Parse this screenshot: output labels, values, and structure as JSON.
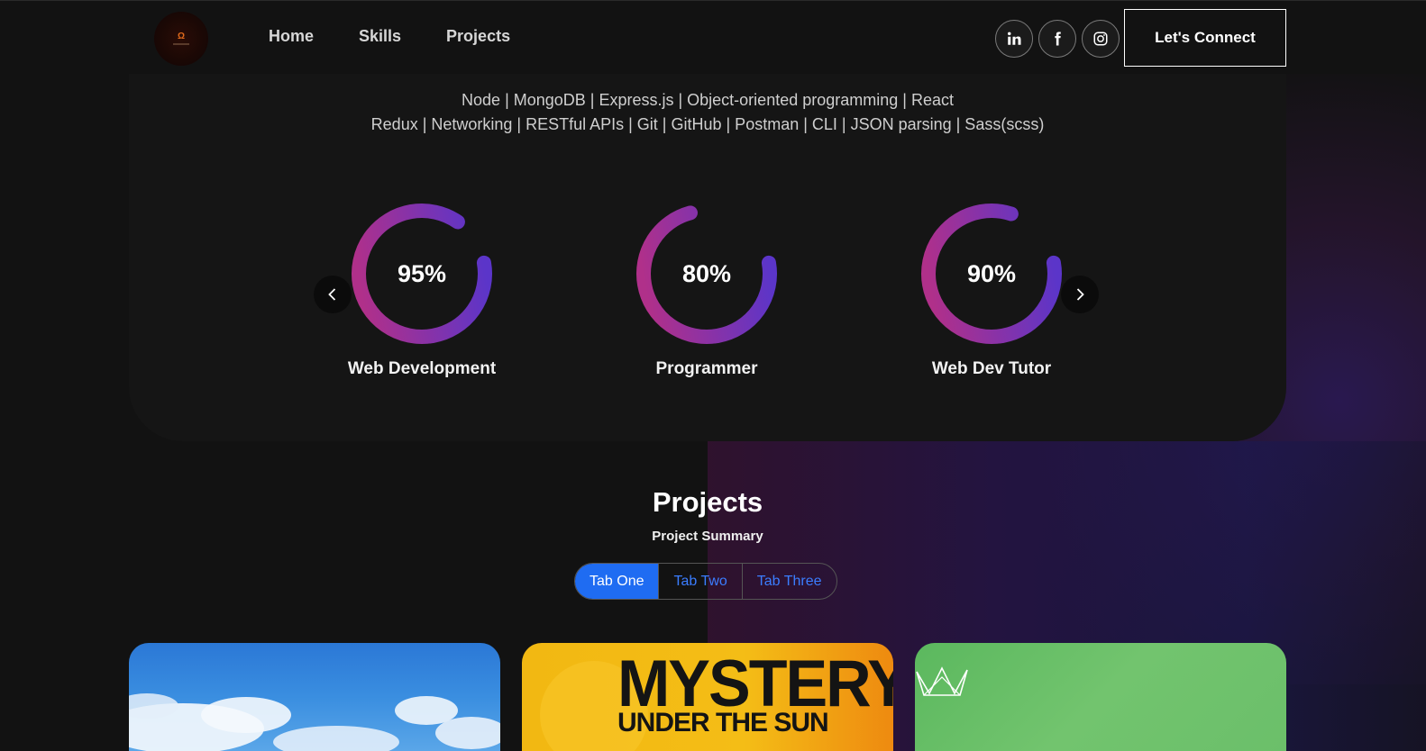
{
  "nav": {
    "links": [
      "Home",
      "Skills",
      "Projects"
    ],
    "connect_label": "Let's Connect",
    "socials": [
      "linkedin-icon",
      "facebook-icon",
      "instagram-icon"
    ]
  },
  "skills": {
    "line1": "Node | MongoDB | Express.js | Object-oriented programming | React",
    "line2": "Redux | Networking | RESTful APIs | Git | GitHub | Postman | CLI | JSON parsing | Sass(scss)",
    "items": [
      {
        "label": "Web Development",
        "percent_text": "95%",
        "percent": 95
      },
      {
        "label": "Programmer",
        "percent_text": "80%",
        "percent": 80
      },
      {
        "label": "Web Dev Tutor",
        "percent_text": "90%",
        "percent": 90
      }
    ]
  },
  "projects": {
    "title": "Projects",
    "subtitle": "Project Summary",
    "tabs": [
      "Tab One",
      "Tab Two",
      "Tab Three"
    ],
    "active_tab": 0,
    "cards": [
      {
        "art": "sky"
      },
      {
        "art": "mystery",
        "text_line1": "MYSTERY",
        "text_line2": "UNDER THE SUN"
      },
      {
        "art": "green"
      }
    ]
  },
  "colors": {
    "ring_start": "#b0308a",
    "ring_end": "#5b35c9",
    "tab_active": "#1f6cf2",
    "tab_text": "#3b7dff"
  }
}
